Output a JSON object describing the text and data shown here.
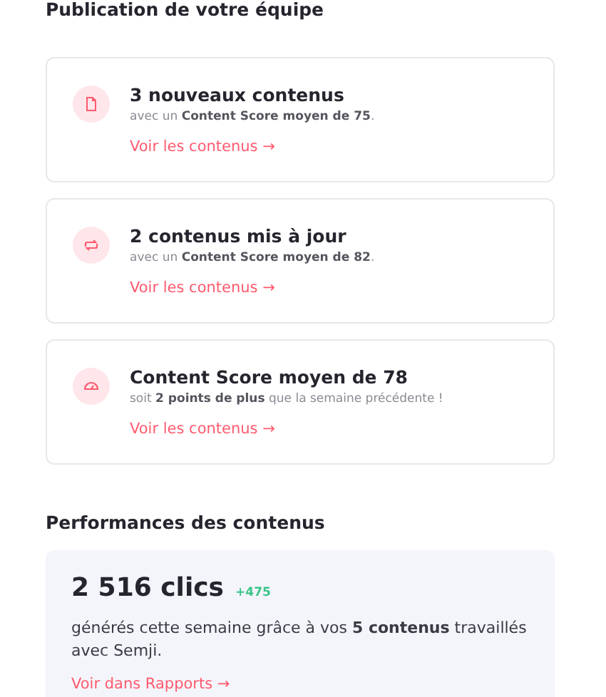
{
  "team_section": {
    "title": "Publication de votre équipe",
    "cards": [
      {
        "kind": "document",
        "title": "3 nouveaux contenus",
        "subtitle": "avec un **Content Score moyen de 75**.",
        "link": "Voir les contenus →"
      },
      {
        "kind": "refresh",
        "title": "2 contenus mis à jour",
        "subtitle": "avec un **Content Score moyen de 82**.",
        "link": "Voir les contenus →"
      },
      {
        "kind": "gauge",
        "title": "Content Score moyen de 78",
        "subtitle": "soit **2 points de plus** que la semaine précédente !",
        "link": "Voir les contenus →"
      }
    ]
  },
  "performance_section": {
    "title": "Performances des contenus",
    "clicks": "2 516 clics",
    "delta": "+475",
    "text": "générés cette semaine grâce à vos **5 contenus** travaillés avec Semji.",
    "link": "Voir dans Rapports →"
  }
}
